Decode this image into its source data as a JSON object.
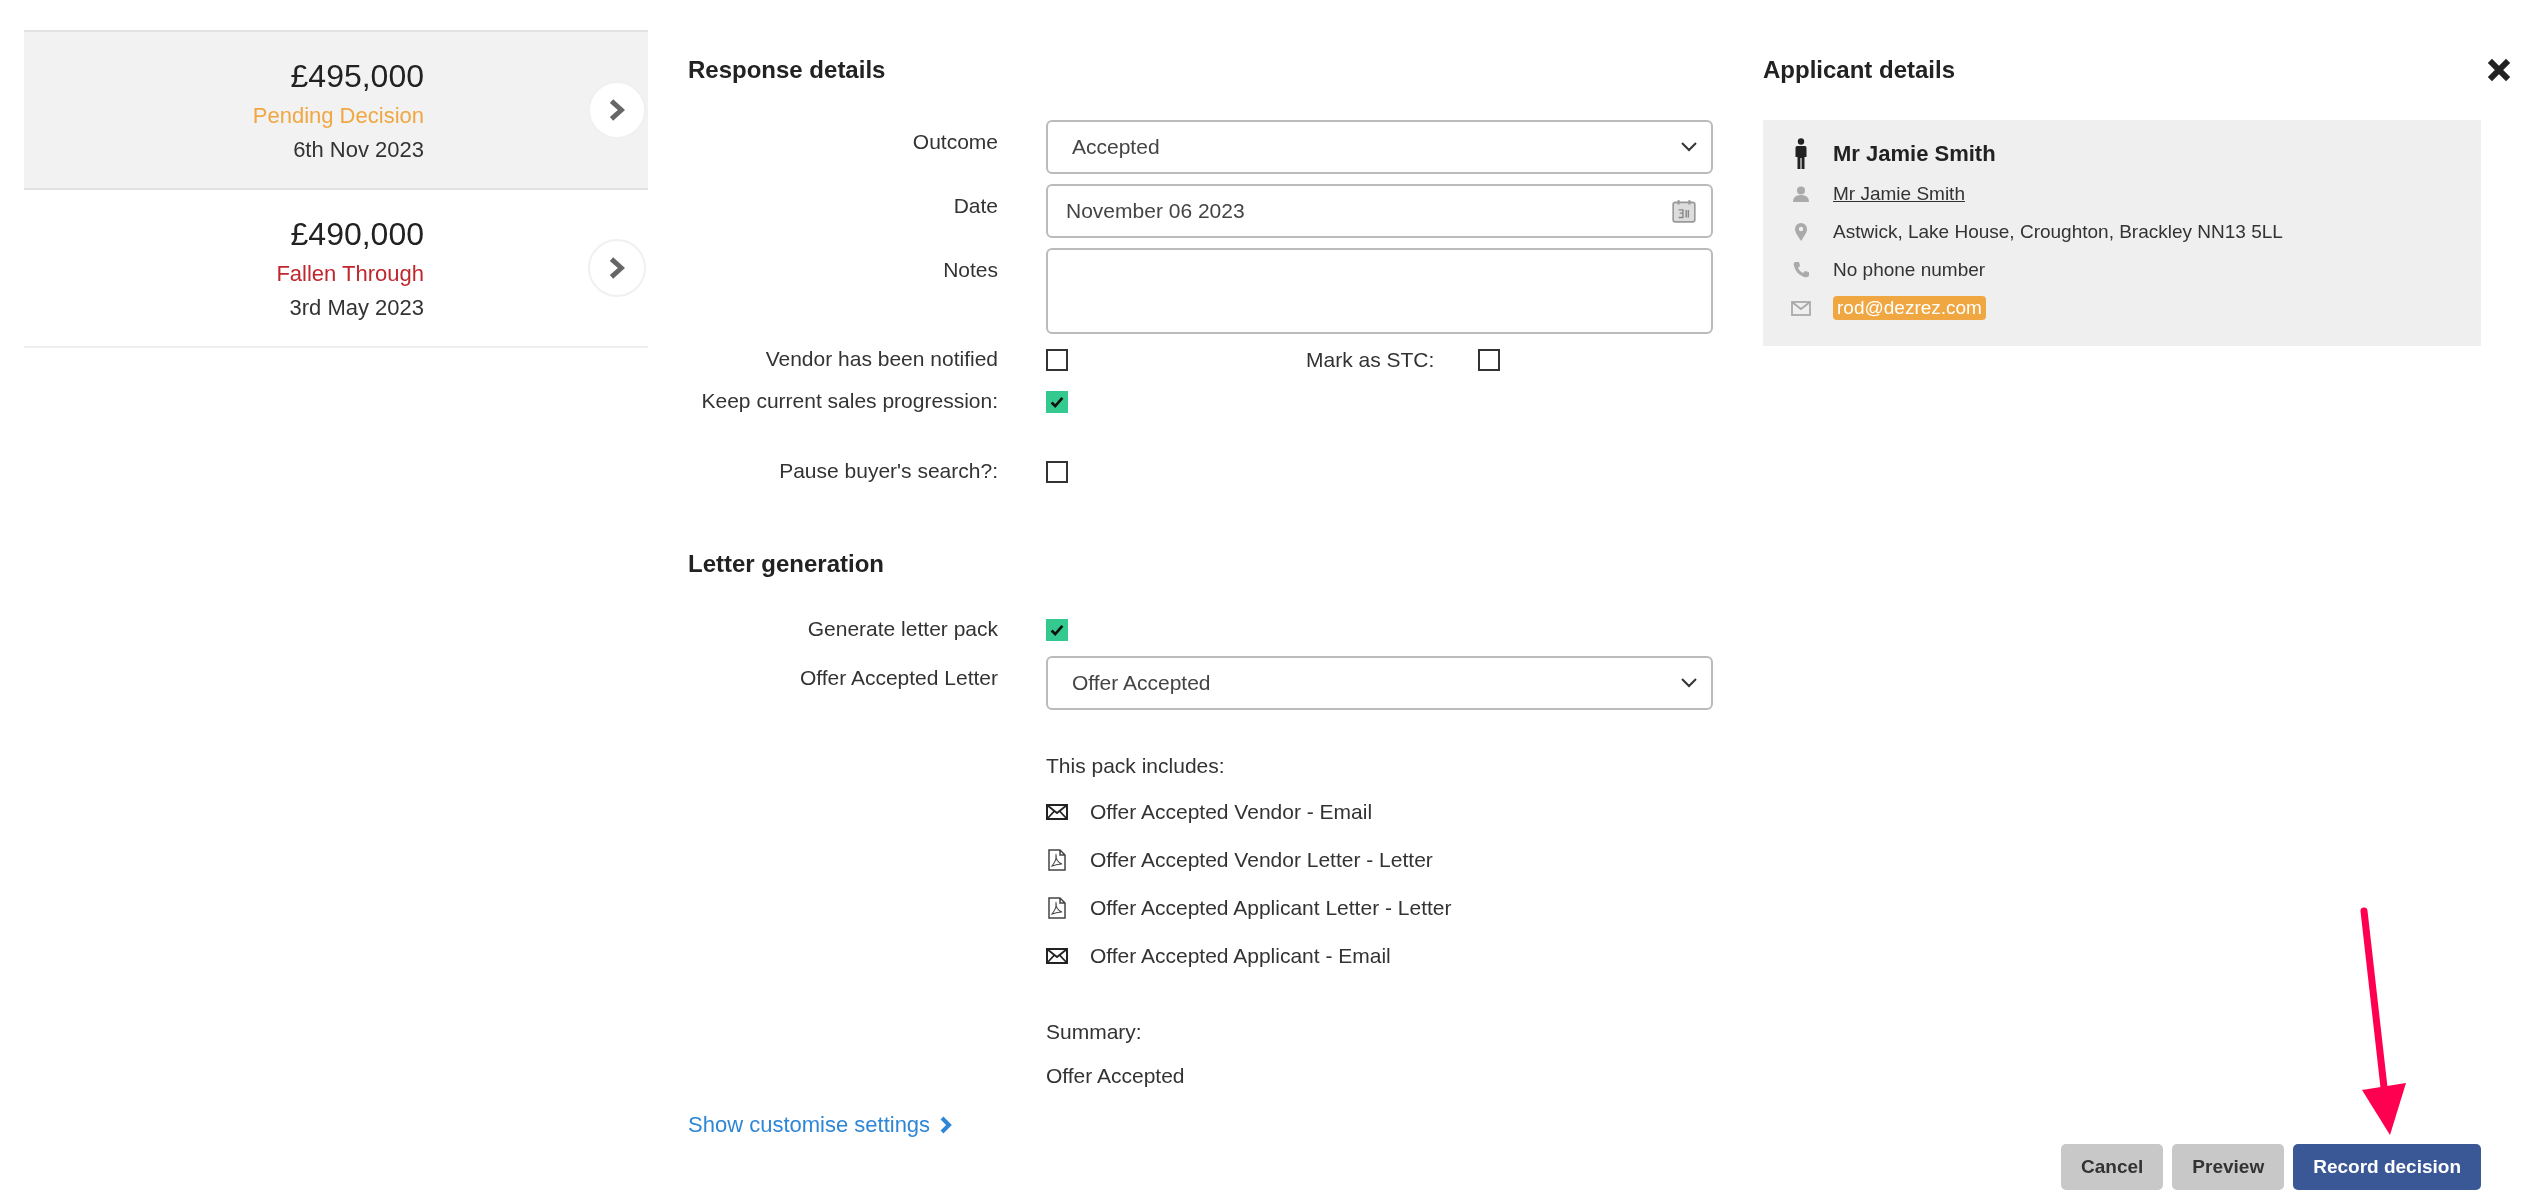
{
  "offers": [
    {
      "price": "£495,000",
      "status": "Pending Decision",
      "color": "#f0a742",
      "date": "6th Nov 2023",
      "selected": true
    },
    {
      "price": "£490,000",
      "status": "Fallen Through",
      "color": "#c0272d",
      "date": "3rd May 2023",
      "selected": false
    }
  ],
  "response_details": {
    "title": "Response details",
    "outcome": {
      "label": "Outcome",
      "value": "Accepted"
    },
    "date": {
      "label": "Date",
      "value": "November 06 2023"
    },
    "notes": {
      "label": "Notes"
    },
    "vendor_notified": {
      "label": "Vendor has been notified",
      "checked": false
    },
    "mark_stc": {
      "label": "Mark as STC:",
      "checked": false
    },
    "keep_progression": {
      "label": "Keep current sales progression:",
      "checked": true
    },
    "pause_search": {
      "label": "Pause buyer's search?:",
      "checked": false
    }
  },
  "letter_generation": {
    "title": "Letter generation",
    "generate_pack": {
      "label": "Generate letter pack",
      "checked": true
    },
    "letter": {
      "label": "Offer Accepted Letter",
      "value": "Offer Accepted"
    },
    "pack_heading": "This pack includes:",
    "pack_items": [
      {
        "kind": "email",
        "label": "Offer Accepted Vendor - Email"
      },
      {
        "kind": "letter",
        "label": "Offer Accepted Vendor Letter - Letter"
      },
      {
        "kind": "letter",
        "label": "Offer Accepted Applicant Letter - Letter"
      },
      {
        "kind": "email",
        "label": "Offer Accepted Applicant - Email"
      }
    ],
    "summary_label": "Summary:",
    "summary": "Offer Accepted"
  },
  "customise_link": "Show customise settings",
  "applicant": {
    "title": "Applicant details",
    "name": "Mr Jamie Smith",
    "contact": "Mr Jamie Smith",
    "address": "Astwick, Lake House, Croughton, Brackley NN13 5LL",
    "phone": "No phone number",
    "email": "rod@dezrez.com"
  },
  "buttons": [
    {
      "kind": "secondary",
      "label": "Cancel"
    },
    {
      "kind": "secondary",
      "label": "Preview"
    },
    {
      "kind": "primary",
      "label": "Record decision"
    }
  ]
}
